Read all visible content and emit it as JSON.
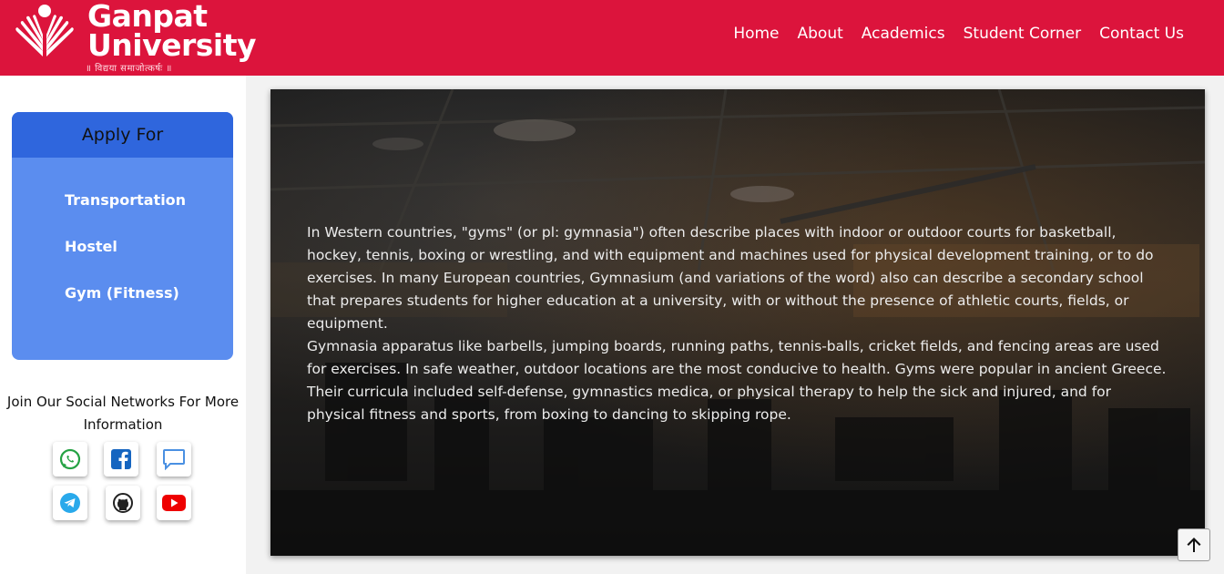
{
  "header": {
    "logo_line1": "Ganpat",
    "logo_line2": "University",
    "logo_tagline": "॥ विद्यया समाजोत्कर्षः ॥",
    "nav": [
      "Home",
      "About",
      "Academics",
      "Student Corner",
      "Contact Us"
    ],
    "bg_color": "#dc143c"
  },
  "sidebar": {
    "apply_title": "Apply For",
    "apply_items": [
      "Transportation",
      "Hostel",
      "Gym (Fitness)"
    ],
    "social_title": "Join Our Social Networks For More Information",
    "social_icons": [
      "whatsapp-icon",
      "facebook-icon",
      "chat-icon",
      "telegram-icon",
      "github-icon",
      "youtube-icon"
    ]
  },
  "main": {
    "paragraph1": "In Western countries, \"gyms\" (or pl: gymnasia\") often describe places with indoor or outdoor courts for basketball, hockey, tennis, boxing or wrestling, and with equipment and machines used for physical development training, or to do exercises. In many European countries, Gymnasium (and variations of the word) also can describe a secondary school that prepares students for higher education at a university, with or without the presence of athletic courts, fields, or equipment.",
    "paragraph2": "Gymnasia apparatus like barbells, jumping boards, running paths, tennis-balls, cricket fields, and fencing areas are used for exercises. In safe weather, outdoor locations are the most conducive to health. Gyms were popular in ancient Greece. Their curricula included self-defense, gymnastics medica, or physical therapy to help the sick and injured, and for physical fitness and sports, from boxing to dancing to skipping rope."
  },
  "scroll_top_icon": "arrow-up-icon"
}
